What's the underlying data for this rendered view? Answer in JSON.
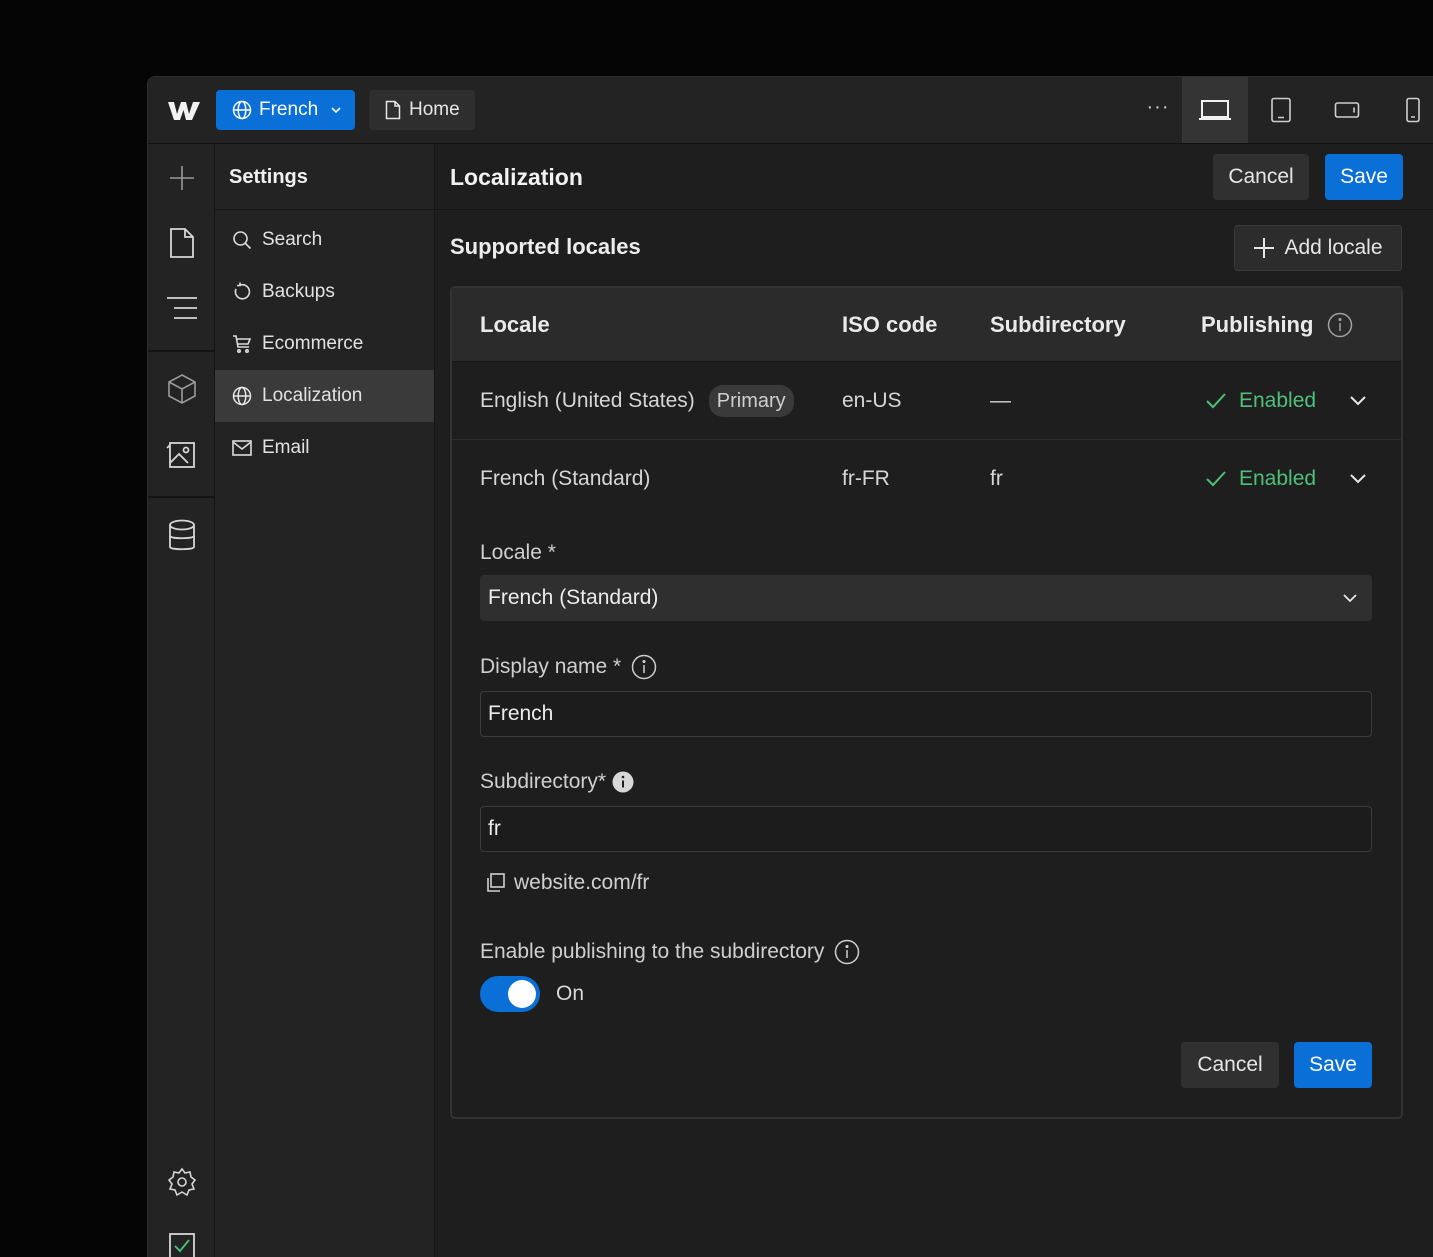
{
  "topbar": {
    "locale_button": "French",
    "page_button": "Home"
  },
  "settings": {
    "title": "Settings",
    "items": [
      {
        "label": "Search"
      },
      {
        "label": "Backups"
      },
      {
        "label": "Ecommerce"
      },
      {
        "label": "Localization"
      },
      {
        "label": "Email"
      }
    ]
  },
  "main": {
    "title": "Localization",
    "cancel_label": "Cancel",
    "save_label": "Save",
    "section_title": "Supported locales",
    "add_locale_label": "Add locale",
    "table": {
      "headers": [
        "Locale",
        "ISO code",
        "Subdirectory",
        "Publishing"
      ],
      "rows": [
        {
          "locale": "English (United States)",
          "badge": "Primary",
          "iso": "en-US",
          "subdirectory": "—",
          "publishing": "Enabled"
        },
        {
          "locale": "French (Standard)",
          "iso": "fr-FR",
          "subdirectory": "fr",
          "publishing": "Enabled"
        }
      ]
    },
    "form": {
      "locale_label": "Locale *",
      "locale_value": "French (Standard)",
      "display_name_label": "Display name *",
      "display_name_value": "French",
      "subdirectory_label": "Subdirectory*",
      "subdirectory_value": "fr",
      "url_preview": "website.com/fr",
      "publishing_label": "Enable publishing to the subdirectory",
      "toggle_state": "On",
      "cancel_label": "Cancel",
      "save_label": "Save"
    }
  },
  "colors": {
    "accent": "#0a6fd6",
    "success": "#4fc07a",
    "background": "#1e1e1e"
  }
}
